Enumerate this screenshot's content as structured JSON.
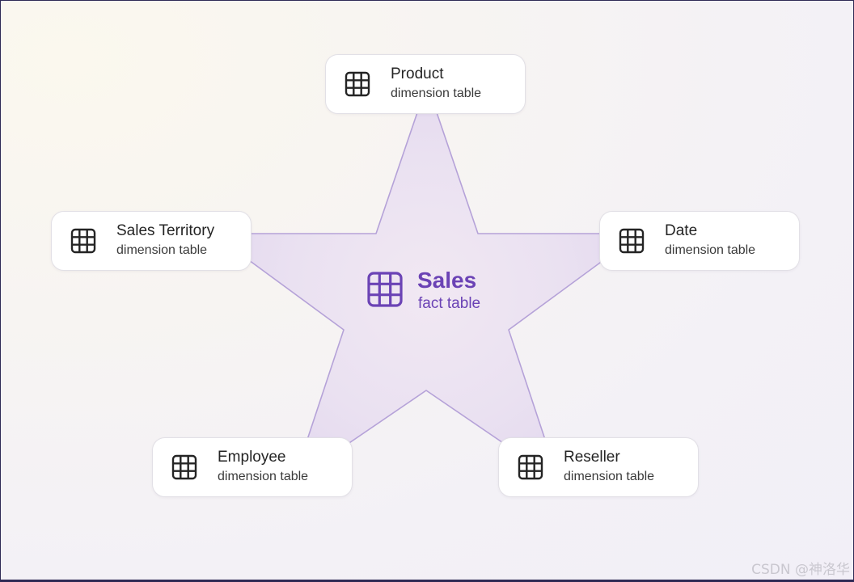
{
  "diagram": {
    "fact_table": {
      "title": "Sales",
      "subtitle": "fact table",
      "icon": "table-grid-icon"
    },
    "dimensions": [
      {
        "key": "product",
        "title": "Product",
        "subtitle": "dimension table",
        "icon": "table-grid-icon"
      },
      {
        "key": "date",
        "title": "Date",
        "subtitle": "dimension table",
        "icon": "table-grid-icon"
      },
      {
        "key": "reseller",
        "title": "Reseller",
        "subtitle": "dimension table",
        "icon": "table-grid-icon"
      },
      {
        "key": "employee",
        "title": "Employee",
        "subtitle": "dimension table",
        "icon": "table-grid-icon"
      },
      {
        "key": "sales_territory",
        "title": "Sales Territory",
        "subtitle": "dimension table",
        "icon": "table-grid-icon"
      }
    ],
    "colors": {
      "accent": "#6b43b5",
      "star_stroke": "#b5a2d8",
      "star_fill": "#ece4f2"
    }
  },
  "watermark": "CSDN @神洛华"
}
